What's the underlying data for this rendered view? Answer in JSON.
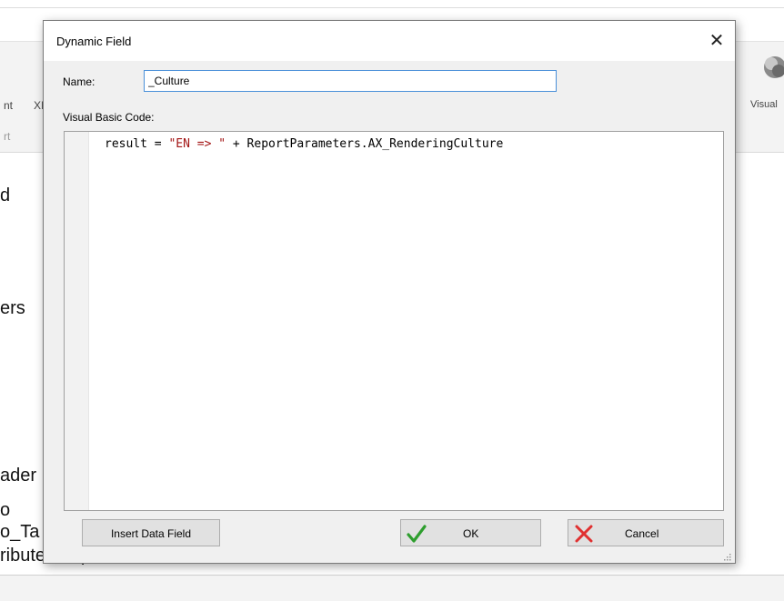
{
  "background": {
    "ribbon": {
      "partial_label_1": "nt",
      "partial_label_2": "XI",
      "partial_group": "rt",
      "visual_label": "Visual"
    },
    "list_fragments": [
      "d",
      "ers",
      "ader",
      "o",
      "o_Ta",
      "ributesTmp"
    ]
  },
  "dialog": {
    "title": "Dynamic Field",
    "close_glyph": "✕",
    "name_label": "Name:",
    "name_value": "_Culture",
    "code_label": "Visual Basic Code:",
    "code": {
      "prefix": "result = ",
      "string_literal": "\"EN => \"",
      "suffix": " + ReportParameters.AX_RenderingCulture"
    },
    "buttons": {
      "insert_label": "Insert Data Field",
      "ok_label": "OK",
      "cancel_label": "Cancel"
    },
    "icons": {
      "ok": "checkmark-icon",
      "cancel": "x-icon",
      "ok_color": "#2e9e2e",
      "cancel_color": "#e03030"
    }
  }
}
